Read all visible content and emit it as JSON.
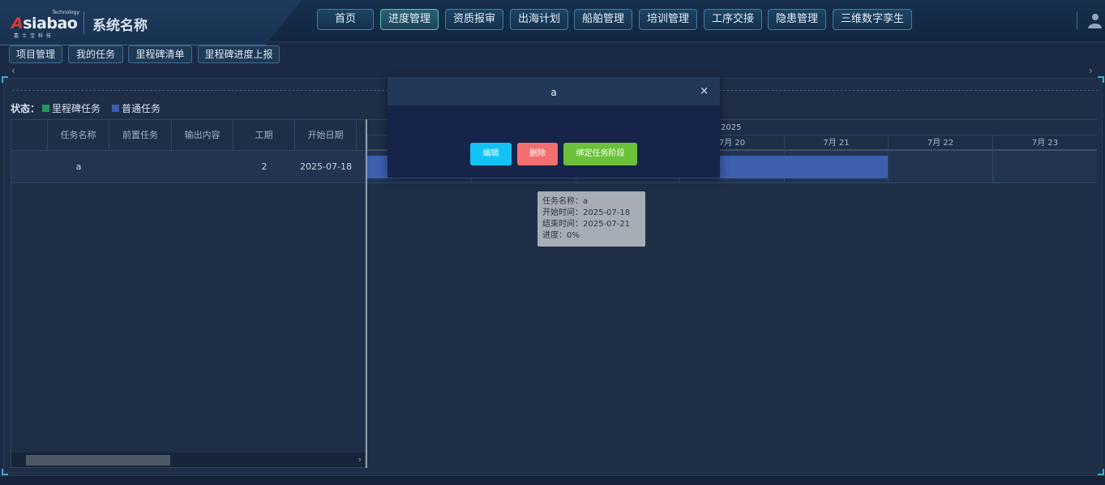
{
  "brand": {
    "logo_top": "Technology",
    "logo_main_a": "A",
    "logo_main_rest": "siabao",
    "logo_sub": "嘉士宝科技",
    "system_name": "系统名称"
  },
  "nav": {
    "items": [
      "首页",
      "进度管理",
      "资质报审",
      "出海计划",
      "船舶管理",
      "培训管理",
      "工序交接",
      "隐患管理",
      "三维数字孪生"
    ],
    "active_index": 1
  },
  "subtabs": [
    "项目管理",
    "我的任务",
    "里程碑清单",
    "里程碑进度上报"
  ],
  "legend": {
    "label": "状态：",
    "milestone": "里程碑任务",
    "normal": "普通任务",
    "milestone_color": "#1f9a5a",
    "normal_color": "#3c5fae"
  },
  "table": {
    "columns": [
      "任务名称",
      "前置任务",
      "输出内容",
      "工期",
      "开始日期"
    ],
    "rows": [
      {
        "name": "a",
        "predecessor": "",
        "output": "",
        "duration": "2",
        "start": "2025-07-18"
      }
    ]
  },
  "gantt": {
    "year": "2025",
    "days": [
      "",
      "",
      "",
      "7月 20",
      "7月 21",
      "7月 22",
      "7月 23"
    ]
  },
  "popup": {
    "title": "a",
    "close_icon": "×",
    "buttons": {
      "edit": "编辑",
      "delete": "删除",
      "bind": "绑定任务阶段"
    },
    "colors": {
      "edit": "#12c2f5",
      "delete": "#f36f6f",
      "bind": "#6cc13b"
    }
  },
  "tooltip": {
    "name": "任务名称：a",
    "start": "开始时间：2025-07-18",
    "end": "结束时间：2025-07-21",
    "progress": "进度：0%"
  },
  "icons": {
    "scroll_left": "‹",
    "scroll_right": "›",
    "hscroll_right": "›"
  }
}
